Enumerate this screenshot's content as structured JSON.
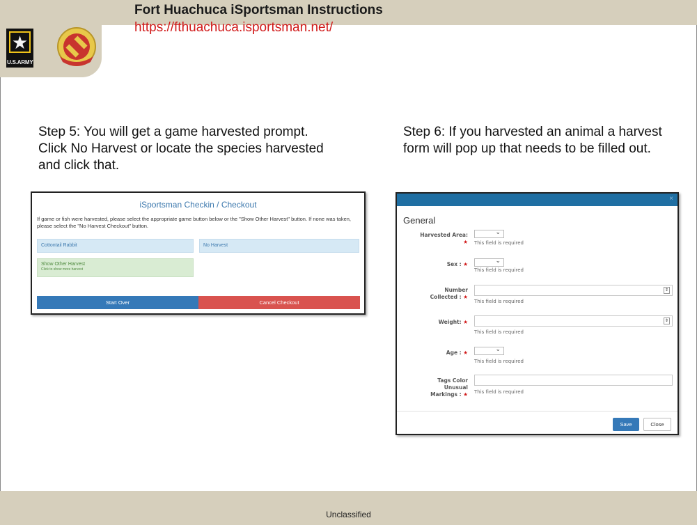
{
  "header": {
    "title": "Fort Huachuca iSportsman Instructions",
    "url": "https://fthuachuca.isportsman.net/",
    "army_logo_text": "U.S.ARMY",
    "colors": {
      "band": "#d6cfbc",
      "url": "#d11a1a"
    }
  },
  "steps": {
    "step5": "Step 5: You will get a game harvested prompt. Click No Harvest or locate the species harvested and click that.",
    "step6": "Step 6: If you harvested an animal a harvest form will pop up that needs to be filled out."
  },
  "checkin": {
    "title": "iSportsman Checkin / Checkout",
    "description": "If game or fish were harvested, please select the appropriate game button below or the \"Show Other Harvest\" button. If none was taken, please select the \"No Harvest Checkout\" button.",
    "buttons": {
      "cottontail": "Cottontail Rabbit",
      "no_harvest": "No Harvest",
      "show_other": "Show Other Harvest",
      "show_other_sub": "Click to show more harvest",
      "start_over": "Start Over",
      "cancel_checkout": "Cancel Checkout"
    }
  },
  "harvest_form": {
    "close_glyph": "×",
    "section_title": "General",
    "required_msg": "This field is required",
    "required_mark": "★",
    "fields": {
      "harvested_area": "Harvested Area:",
      "sex": "Sex :",
      "number_collected_1": "Number",
      "number_collected_2": "Collected :",
      "weight": "Weight:",
      "age": "Age :",
      "tags_1": "Tags Color",
      "tags_2": "Unusual",
      "tags_3": "Markings :"
    },
    "buttons": {
      "save": "Save",
      "close": "Close"
    }
  },
  "footer": {
    "classification": "Unclassified"
  }
}
